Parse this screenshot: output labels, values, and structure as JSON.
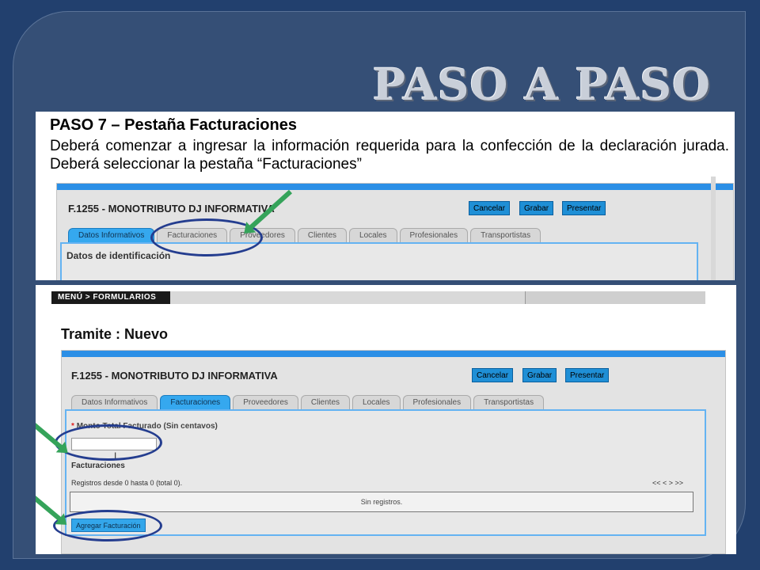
{
  "slide": {
    "title": "PASO A PASO"
  },
  "instruction": {
    "heading": "PASO 7 – Pestaña Facturaciones",
    "body": "Deberá comenzar a ingresar la información requerida para la confección de la declaración jurada. Deberá seleccionar la pestaña “Facturaciones”"
  },
  "screen1": {
    "form_title": "F.1255 - MONOTRIBUTO DJ INFORMATIVA",
    "buttons": [
      "Cancelar",
      "Grabar",
      "Presentar"
    ],
    "tabs": [
      "Datos Informativos",
      "Facturaciones",
      "Proveedores",
      "Clientes",
      "Locales",
      "Profesionales",
      "Transportistas"
    ],
    "active_tab": "Datos Informativos",
    "section_label": "Datos de identificación"
  },
  "screen2": {
    "menu": "MENÚ > FORMULARIOS",
    "page_title": "Tramite : Nuevo",
    "form_title": "F.1255 - MONOTRIBUTO DJ INFORMATIVA",
    "buttons": [
      "Cancelar",
      "Grabar",
      "Presentar"
    ],
    "tabs": [
      "Datos Informativos",
      "Facturaciones",
      "Proveedores",
      "Clientes",
      "Locales",
      "Profesionales",
      "Transportistas"
    ],
    "active_tab": "Facturaciones",
    "required_mark": "*",
    "field_label": "Monto Total Facturado (Sin centavos)",
    "field_value": "",
    "section_label": "Facturaciones",
    "records_info": "Registros desde 0 hasta 0 (total 0).",
    "pagination": "<< < > >>",
    "empty_table": "Sin registros.",
    "add_button": "Agregar Facturación"
  },
  "colors": {
    "background": "#22406e",
    "frame": "#354f76",
    "accent_blue": "#2b8fe6",
    "highlight_ellipse": "#243d8f",
    "arrow_green": "#35a35a"
  }
}
